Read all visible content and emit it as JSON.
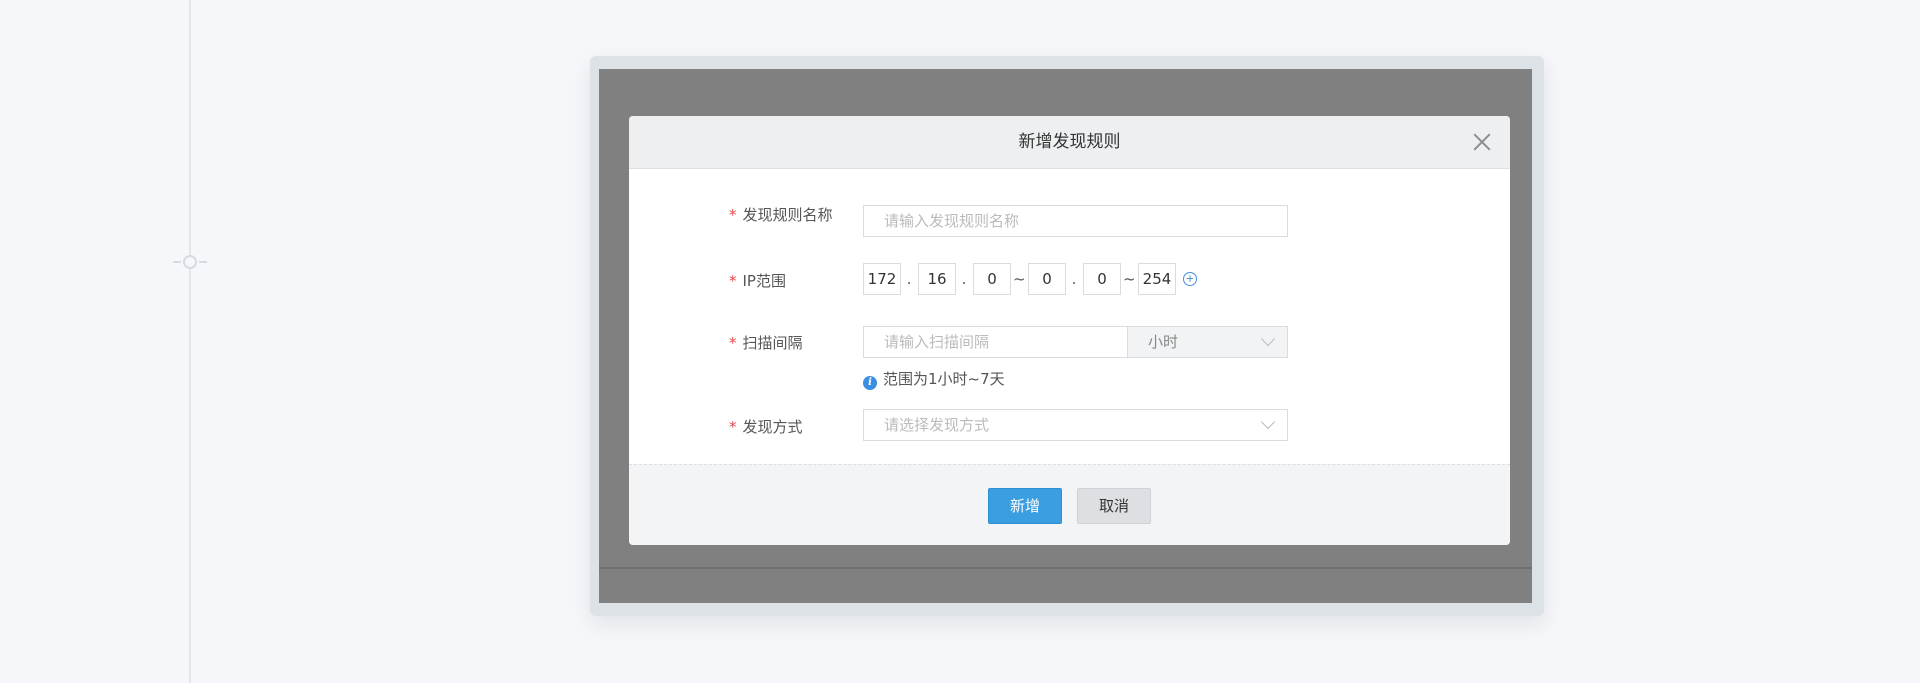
{
  "dialog": {
    "title": "新增发现规则",
    "fields": {
      "rule_name": {
        "label": "发现规则名称",
        "required_mark": "*",
        "placeholder": "请输入发现规则名称",
        "value": ""
      },
      "ip_range": {
        "label": "IP范围",
        "required_mark": "*",
        "start": [
          "172",
          "16",
          "0"
        ],
        "middle": "0",
        "end": [
          "0",
          "254"
        ],
        "dot": ".",
        "tilde": "~"
      },
      "scan_interval": {
        "label": "扫描间隔",
        "required_mark": "*",
        "placeholder": "请输入扫描间隔",
        "unit": "小时",
        "hint": "范围为1小时~7天",
        "hint_icon": "info-icon"
      },
      "discovery_method": {
        "label": "发现方式",
        "required_mark": "*",
        "placeholder": "请选择发现方式"
      }
    },
    "buttons": {
      "confirm": "新增",
      "cancel": "取消"
    },
    "icons": {
      "close": "close-icon",
      "add_range": "plus-circle-icon",
      "dropdown": "chevron-down-icon"
    }
  },
  "colors": {
    "primary": "#3a9ee0",
    "required": "#e8474b",
    "info": "#3b8fe0",
    "overlay": "#808080"
  }
}
